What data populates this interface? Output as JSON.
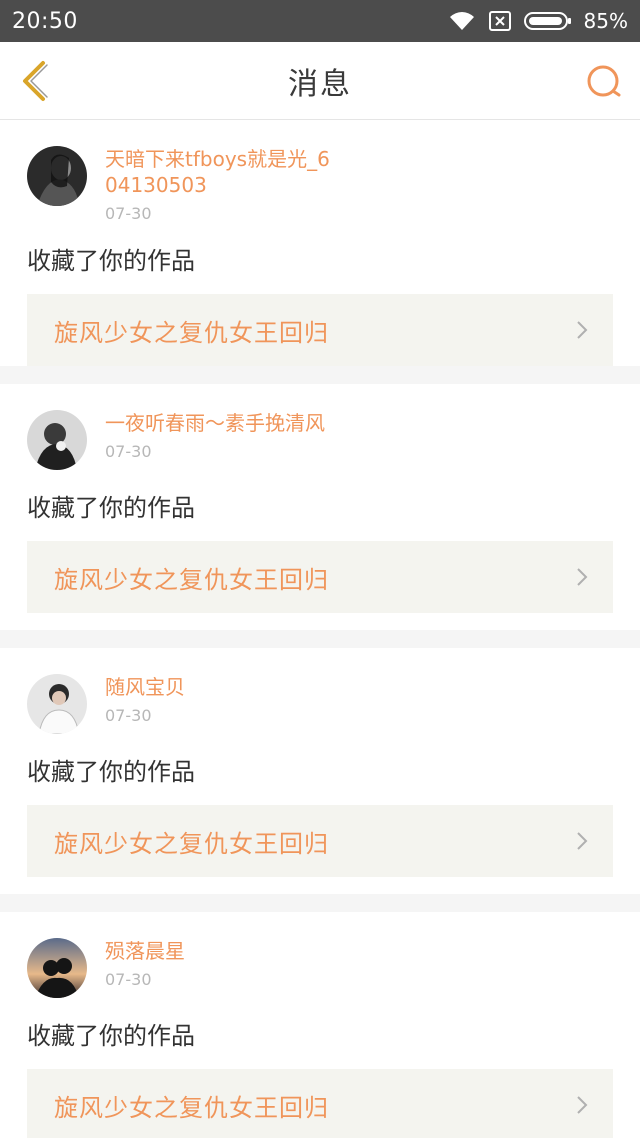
{
  "status": {
    "time": "20:50",
    "battery": "85%"
  },
  "nav": {
    "title": "消息"
  },
  "colors": {
    "accent": "#f0955a",
    "back_chevron": "#d9a52a",
    "status_bg": "#4c4c4c"
  },
  "messages": [
    {
      "user": "天暗下来tfboys就是光_604130503",
      "date": "07-30",
      "action": "收藏了你的作品",
      "work": "旋风少女之复仇女王回归",
      "avatar": "dark-portrait"
    },
    {
      "user": "一夜听春雨～素手挽清风",
      "date": "07-30",
      "action": "收藏了你的作品",
      "work": "旋风少女之复仇女王回归",
      "avatar": "monochrome-girl"
    },
    {
      "user": "随风宝贝",
      "date": "07-30",
      "action": "收藏了你的作品",
      "work": "旋风少女之复仇女王回归",
      "avatar": "white-shirt-boy"
    },
    {
      "user": "殒落晨星",
      "date": "07-30",
      "action": "收藏了你的作品",
      "work": "旋风少女之复仇女王回归",
      "avatar": "sunset-silhouette"
    }
  ]
}
